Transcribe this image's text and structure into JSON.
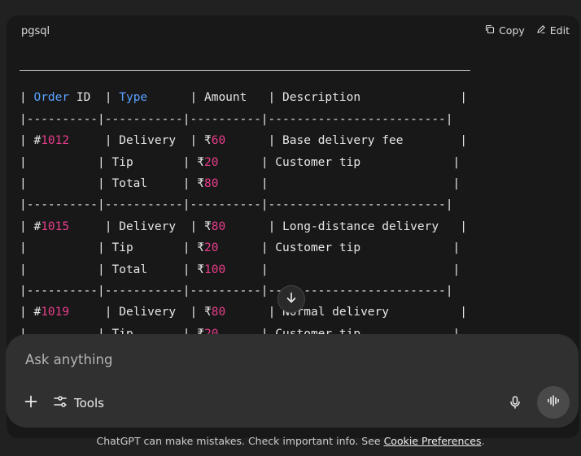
{
  "code_block": {
    "language": "pgsql",
    "copy_label": "Copy",
    "edit_label": "Edit",
    "lines": [
      [
        [
          "| ",
          ""
        ],
        [
          "Order",
          "kw"
        ],
        [
          " ID  | ",
          ""
        ],
        [
          "Type",
          "kw"
        ],
        [
          "      | Amount   | Description              |",
          ""
        ]
      ],
      [
        [
          "|----------|-----------|----------|-------------------------|",
          ""
        ]
      ],
      [
        [
          "| #",
          ""
        ],
        [
          "1012",
          "num"
        ],
        [
          "     | Delivery  | ₹",
          ""
        ],
        [
          "60",
          "num"
        ],
        [
          "      | Base delivery fee        |",
          ""
        ]
      ],
      [
        [
          "|          | Tip       | ₹",
          ""
        ],
        [
          "20",
          "num"
        ],
        [
          "      | Customer tip             |",
          ""
        ]
      ],
      [
        [
          "|          | Total     | ₹",
          ""
        ],
        [
          "80",
          "num"
        ],
        [
          "      |                          |",
          ""
        ]
      ],
      [
        [
          "|----------|-----------|----------|-------------------------|",
          ""
        ]
      ],
      [
        [
          "| #",
          ""
        ],
        [
          "1015",
          "num"
        ],
        [
          "     | Delivery  | ₹",
          ""
        ],
        [
          "80",
          "num"
        ],
        [
          "      | Long-distance delivery   |",
          ""
        ]
      ],
      [
        [
          "|          | Tip       | ₹",
          ""
        ],
        [
          "20",
          "num"
        ],
        [
          "      | Customer tip             |",
          ""
        ]
      ],
      [
        [
          "|          | Total     | ₹",
          ""
        ],
        [
          "100",
          "num"
        ],
        [
          "     |                          |",
          ""
        ]
      ],
      [
        [
          "|----------|-----------|----------|-------------------------|",
          ""
        ]
      ],
      [
        [
          "| #",
          ""
        ],
        [
          "1019",
          "num"
        ],
        [
          "     | Delivery  | ₹",
          ""
        ],
        [
          "80",
          "num"
        ],
        [
          "      | Normal delivery          |",
          ""
        ]
      ],
      [
        [
          "|          | Tip       | ₹",
          ""
        ],
        [
          "20",
          "num"
        ],
        [
          "      | Customer tip             |",
          ""
        ]
      ]
    ]
  },
  "composer": {
    "placeholder": "Ask anything",
    "tools_label": "Tools"
  },
  "footer": {
    "disclaimer_text": "ChatGPT can make mistakes. Check important info. See ",
    "link_text": "Cookie Preferences",
    "end_text": "."
  },
  "icons": {
    "copy": "copy-icon",
    "edit": "edit-icon",
    "scroll": "arrow-down-icon",
    "plus": "plus-icon",
    "tools": "sliders-icon",
    "mic": "microphone-icon",
    "voice": "voice-mode-icon"
  },
  "colors": {
    "keyword": "#5aa2ff",
    "number": "#e83e8c",
    "background": "#212121",
    "code_background": "#181818",
    "composer_background": "#303030"
  }
}
